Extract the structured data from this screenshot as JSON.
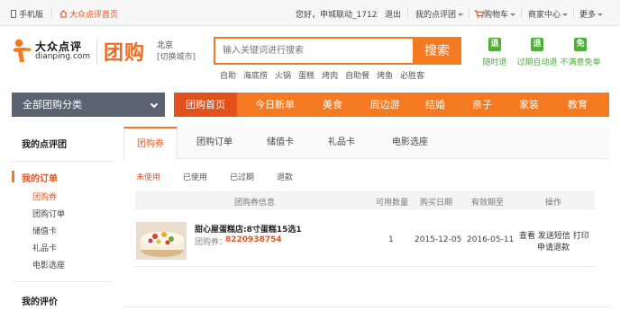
{
  "topbar": {
    "mobile": "手机版",
    "home": "大众点评首页",
    "welcome": "您好，申城联动_1712",
    "logout": "退出",
    "my_dianping": "我的点评团",
    "cart": "购物车",
    "merchant": "商家中心",
    "more": "更多"
  },
  "header": {
    "logo_cn": "大众点评",
    "logo_en_1": "dianping",
    "logo_en_dot": ".",
    "logo_en_2": "com",
    "brand": "团购",
    "city": "北京",
    "city_switch": "[切换城市]",
    "search_placeholder": "输入关键词进行搜索",
    "search_button": "搜索",
    "hotwords": [
      "自助",
      "海底捞",
      "火锅",
      "蛋糕",
      "烤肉",
      "自助餐",
      "烤鱼",
      "必胜客"
    ],
    "services": [
      {
        "badge": "退",
        "label": "随时退"
      },
      {
        "badge": "退",
        "label": "过期自动退"
      },
      {
        "badge": "免",
        "label": "不满意免单"
      }
    ]
  },
  "nav": {
    "all_categories": "全部团购分类",
    "items": [
      "团购首页",
      "今日新单",
      "美食",
      "周边游",
      "结婚",
      "亲子",
      "家装",
      "教育"
    ]
  },
  "sidebar": {
    "group_title": "我的点评团",
    "orders_title": "我的订单",
    "orders_items": [
      "团购券",
      "团购订单",
      "储值卡",
      "礼品卡",
      "电影选座"
    ],
    "review_title": "我的评价"
  },
  "tabs": [
    "团购券",
    "团购订单",
    "储值卡",
    "礼品卡",
    "电影选座"
  ],
  "filters": [
    "未使用",
    "已使用",
    "已过期",
    "退款"
  ],
  "table": {
    "headers": [
      "团购券信息",
      "可用数量",
      "购买日期",
      "有效期至",
      "操作"
    ],
    "rows": [
      {
        "name": "甜心屋蛋糕店:8寸蛋糕15选1",
        "code_label": "团购券：",
        "code": "8220938754",
        "quantity": "1",
        "buy_date": "2015-12-05",
        "expire_date": "2016-05-11",
        "ops_line1": "查看 发送短信 打印",
        "ops_line2": "申请退款"
      }
    ]
  }
}
